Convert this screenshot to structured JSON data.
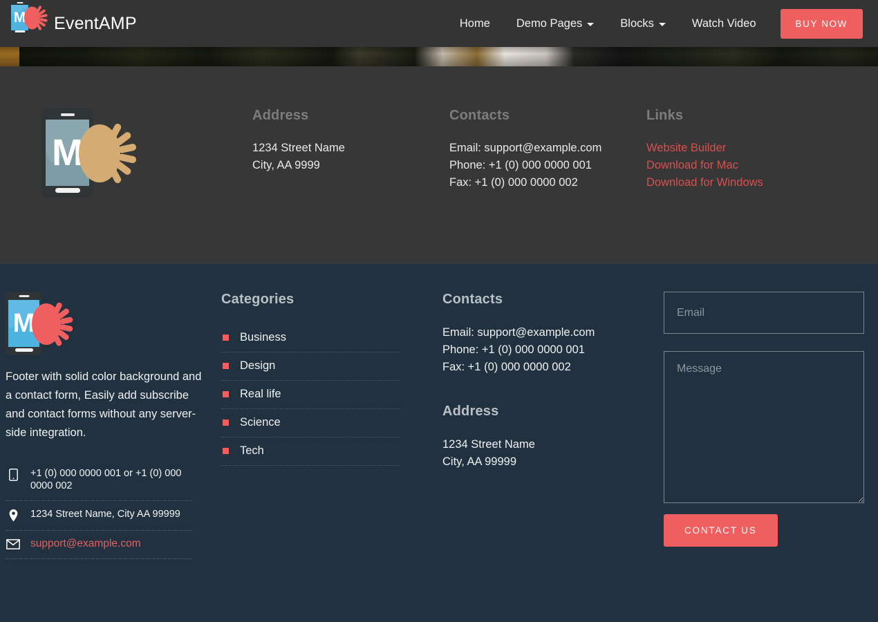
{
  "navbar": {
    "brand": {
      "title": "EventAMP",
      "logo_letter": "M"
    },
    "items": [
      {
        "label": "Home",
        "has_caret": false
      },
      {
        "label": "Demo Pages",
        "has_caret": true
      },
      {
        "label": "Blocks",
        "has_caret": true
      },
      {
        "label": "Watch Video",
        "has_caret": false
      }
    ],
    "cta": {
      "label": "BUY NOW"
    }
  },
  "footer_gray": {
    "logo_letter": "M",
    "address": {
      "heading": "Address",
      "line1": "1234 Street Name",
      "line2": "City, AA 9999"
    },
    "contacts": {
      "heading": "Contacts",
      "email": "Email: support@example.com",
      "phone": "Phone: +1 (0) 000 0000 001",
      "fax": "Fax: +1 (0) 000 0000 002"
    },
    "links": {
      "heading": "Links",
      "items": [
        "Website Builder",
        "Download for Mac",
        "Download for Windows"
      ]
    }
  },
  "footer_navy": {
    "logo_letter": "M",
    "description": "Footer with solid color background and a contact form, Easily add subscribe and contact forms without any server-side integration.",
    "info": [
      {
        "icon": "mobile-icon",
        "text": "+1 (0) 000 0000 001 or +1 (0) 000 0000 002",
        "is_link": false
      },
      {
        "icon": "map-pin-icon",
        "text": "1234 Street Name, City AA 99999",
        "is_link": false
      },
      {
        "icon": "envelope-icon",
        "text": "support@example.com",
        "is_link": true
      }
    ],
    "categories": {
      "heading": "Categories",
      "items": [
        "Business",
        "Design",
        "Real life",
        "Science",
        "Tech"
      ]
    },
    "contacts": {
      "heading": "Contacts",
      "email": "Email: support@example.com",
      "phone": "Phone: +1 (0) 000 0000 001",
      "fax": "Fax: +1 (0) 000 0000 002"
    },
    "address": {
      "heading": "Address",
      "line1": "1234 Street Name",
      "line2": "City, AA 99999"
    },
    "form": {
      "email_placeholder": "Email",
      "email_value": "",
      "message_placeholder": "Message",
      "message_value": "",
      "submit_label": "CONTACT US"
    }
  },
  "colors": {
    "accent": "#ef5f5f",
    "nav_bg": "#343434",
    "footer_gray_bg": "#373737",
    "footer_navy_bg": "#22313f",
    "link_red": "#d65050",
    "heading_gray": "#7d7d7d",
    "sun_gold": "#d4ab72",
    "screen_teal": "#7d9ca5",
    "screen_blue": "#4fb3e0"
  }
}
